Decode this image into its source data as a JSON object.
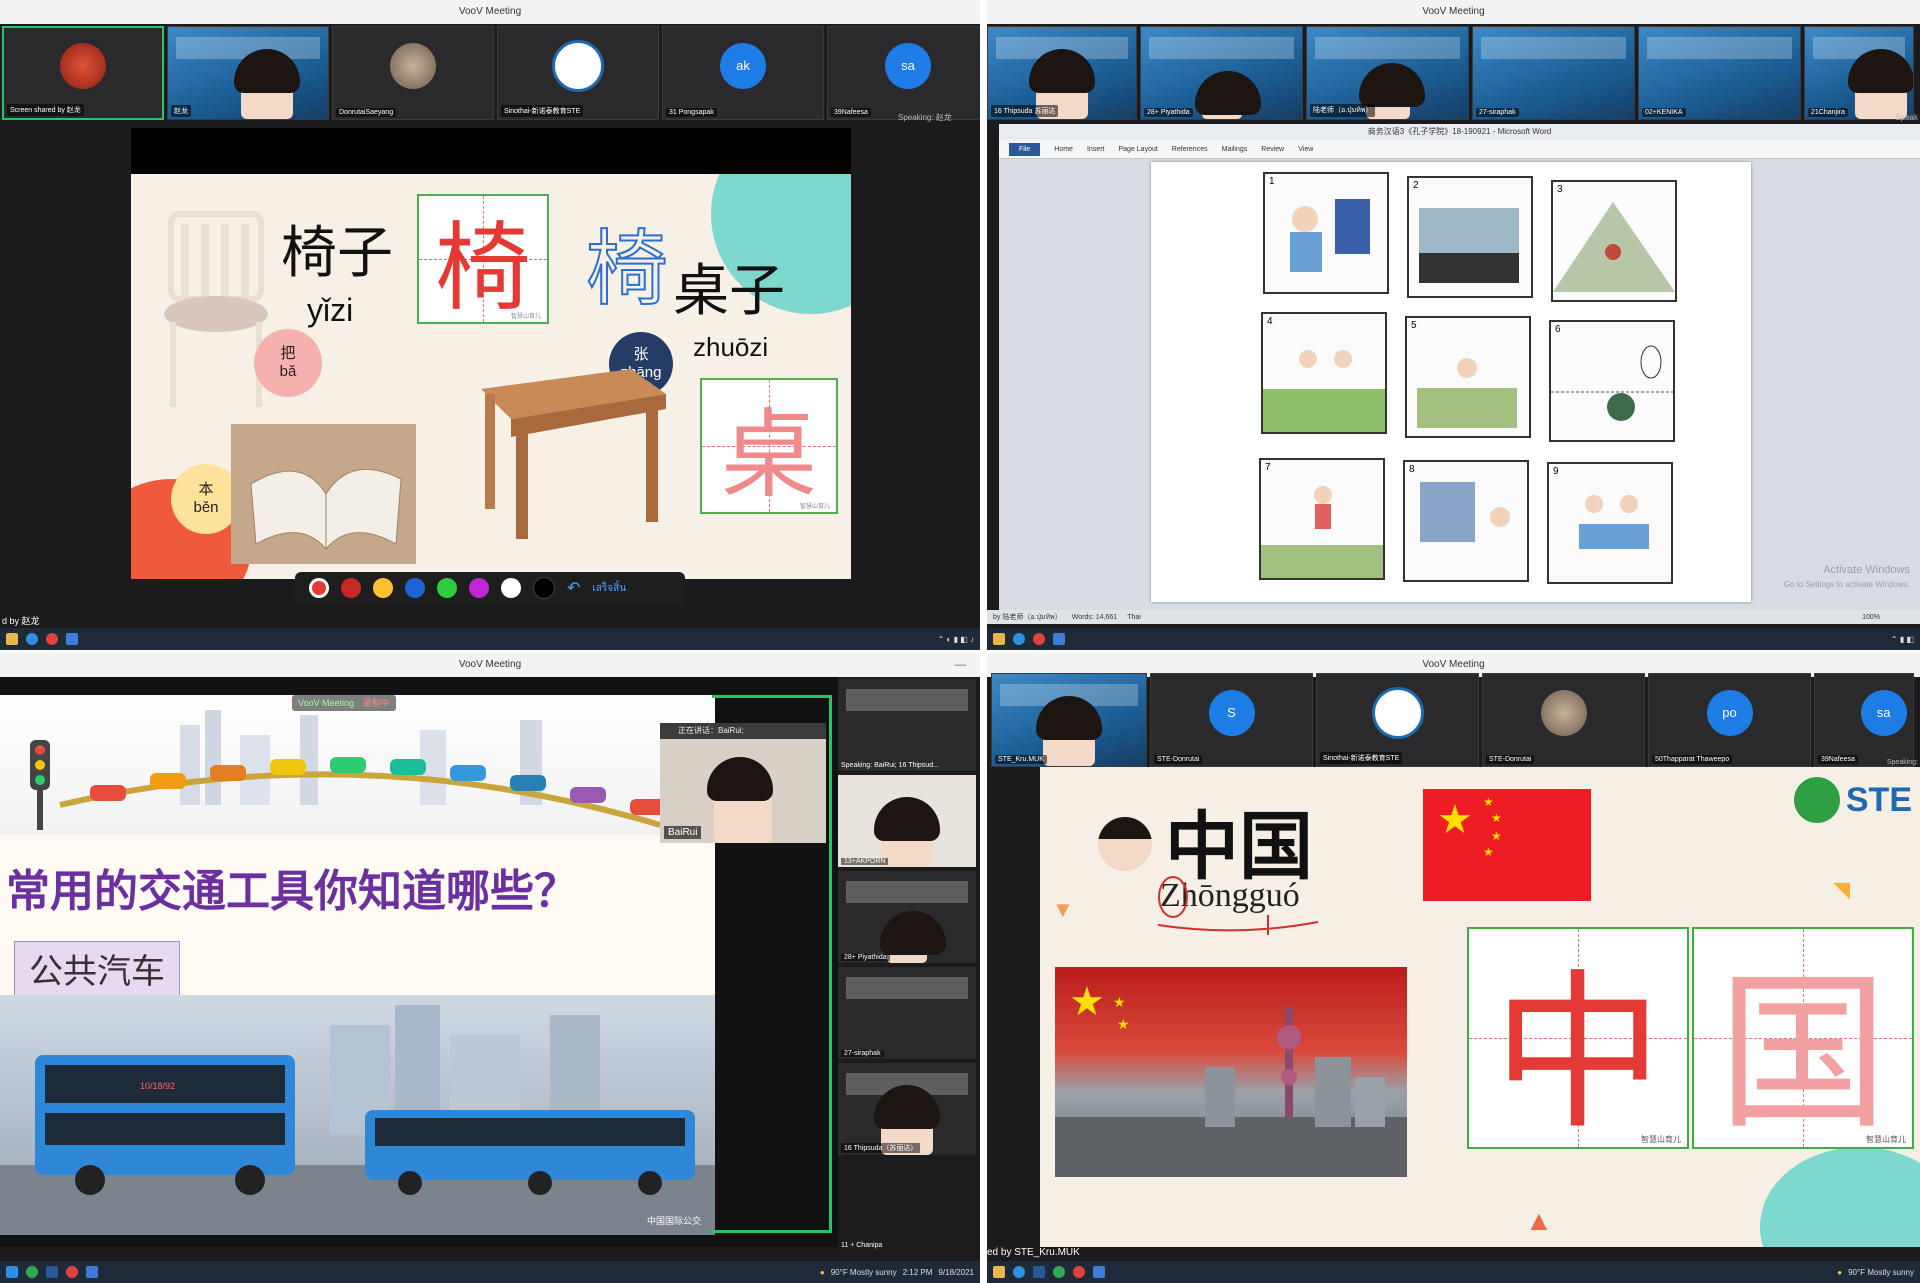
{
  "windows": {
    "top_left": {
      "title": "VooV Meeting",
      "participants": [
        {
          "name": "Screen shared by 赵龙",
          "kind": "avatar-red"
        },
        {
          "name": "赵龙",
          "kind": "camera"
        },
        {
          "name": "DonrutaiSaeyang",
          "kind": "photo"
        },
        {
          "name": "Sinothai-新诺泰教育STE",
          "kind": "logo"
        },
        {
          "name": "31 Pongsapak",
          "kind": "initials",
          "initials": "ak"
        },
        {
          "name": "39Nafeesa",
          "kind": "initials",
          "initials": "sa"
        }
      ],
      "speaking": "Speaking: 赵龙",
      "slide": {
        "word1": "椅子",
        "pinyin1": "yǐzi",
        "grid_char1": "椅",
        "outline_char": "椅",
        "word2": "桌子",
        "pinyin2": "zhuōzi",
        "grid_char2": "桌",
        "measure1": {
          "char": "把",
          "pinyin": "bǎ"
        },
        "measure2": {
          "char": "张",
          "pinyin": "zhāng"
        },
        "measure3": {
          "char": "本",
          "pinyin": "běn"
        },
        "watermark": "智慧山育儿"
      },
      "pen_colors": [
        "#e53935",
        "#c62828",
        "#fbc02d",
        "#1e63d6",
        "#2ecc40",
        "#c026d3",
        "#ffffff",
        "#000000"
      ],
      "done_label": "เสร็จสิ้น",
      "shared_by": "d by 赵龙"
    },
    "top_right": {
      "title": "VooV Meeting",
      "participants": [
        {
          "name": "16 Thipsuda 苏丽达",
          "kind": "camera"
        },
        {
          "name": "28+ Piyathida",
          "kind": "camera"
        },
        {
          "name": "陆老师（อ.ปุ่มทิพ）",
          "kind": "camera"
        },
        {
          "name": "27-siraphak",
          "kind": "slide"
        },
        {
          "name": "02+KENIKA",
          "kind": "slide"
        },
        {
          "name": "21Chanjira",
          "kind": "camera"
        }
      ],
      "speaking": "Speak",
      "word_title": "商务汉语3《孔子学院》18-190921 - Microsoft Word",
      "ribbon_tabs": [
        "File",
        "Home",
        "Insert",
        "Page Layout",
        "References",
        "Mailings",
        "Review",
        "View"
      ],
      "picture_numbers": [
        "1",
        "2",
        "3",
        "4",
        "5",
        "6",
        "7",
        "8",
        "9"
      ],
      "status_words": "Words: 14,661",
      "status_lang": "Thai",
      "zoom": "100%",
      "activate_line1": "Activate Windows",
      "activate_line2": "Go to Settings to activate Windows.",
      "shared_by": "by 陆老师（อ.ปุ่มทิพ）"
    },
    "bottom_left": {
      "title": "VooV Meeting",
      "banner": "VooV Meeting",
      "banner_status": "录制中",
      "slide_question": "常用的交通工具你知道哪些？",
      "slide_label": "公共汽车",
      "slide_watermark": "中国国际公交",
      "bus_route": "10/18/92",
      "pip_name": "BaiRui",
      "pip_speaking": "正在讲话：BaiRui;",
      "right_tiles": [
        {
          "name": "Speaking: BaiRui; 16 Thipsud...",
          "kind": "slide"
        },
        {
          "name": "13+AKPORN",
          "kind": "camera"
        },
        {
          "name": "28+ Piyathida",
          "kind": "slide"
        },
        {
          "name": "27-siraphak",
          "kind": "slide"
        },
        {
          "name": "16 Thipsuda（苏丽达）",
          "kind": "slide"
        },
        {
          "name": "11 + Chanipa",
          "kind": "dark"
        }
      ],
      "weather": "90°F  Mostly sunny",
      "time": "2:12 PM",
      "date": "9/18/2021"
    },
    "bottom_right": {
      "title": "VooV Meeting",
      "participants": [
        {
          "name": "STE_Kru.MUK",
          "kind": "camera"
        },
        {
          "name": "STE-Donrutai",
          "kind": "initials",
          "initials": "S"
        },
        {
          "name": "Sinothai-新诺泰教育STE",
          "kind": "logo"
        },
        {
          "name": "STE-Donrutai",
          "kind": "photo"
        },
        {
          "name": "50Thapparat Thaweepo",
          "kind": "initials",
          "initials": "po"
        },
        {
          "name": "39Nafeesa",
          "kind": "initials",
          "initials": "sa"
        }
      ],
      "speaking": "Speaking:",
      "slide_word": "中国",
      "slide_pinyin": "Zhōngguó",
      "grid_char1": "中",
      "grid_char2": "国",
      "logo_text": "STE",
      "watermark": "智慧山育儿",
      "shared_by": "ed by STE_Kru.MUK",
      "weather": "90°F  Mostly sunny"
    }
  },
  "colors": {
    "voov_blue": "#1d6ab3",
    "accent_green": "#29c46a",
    "grid_red": "#e53935",
    "slide_teal": "#7fd8cf",
    "taskbar": "#1f2a38"
  }
}
